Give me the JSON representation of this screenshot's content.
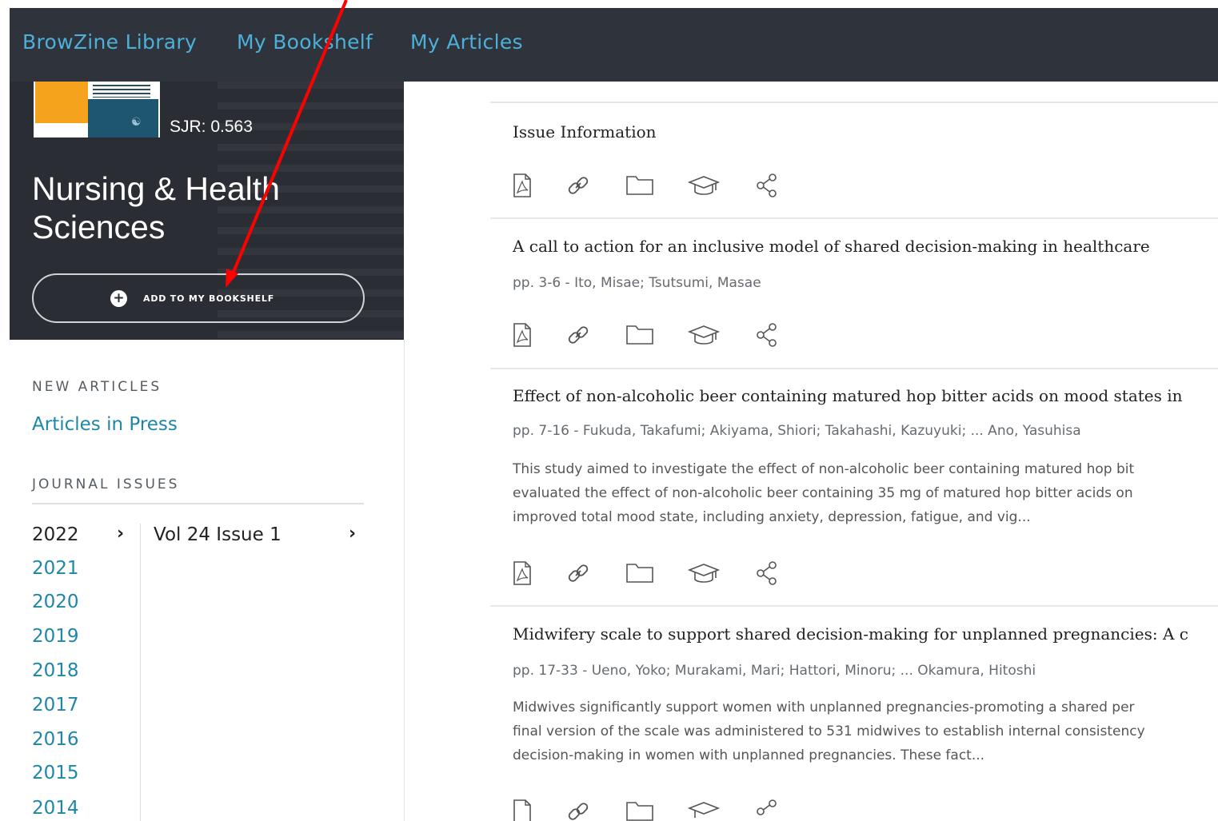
{
  "nav": {
    "items": [
      "BrowZine Library",
      "My Bookshelf",
      "My Articles"
    ]
  },
  "journal": {
    "sjr": "SJR: 0.563",
    "title": "Nursing & Health Sciences",
    "add_button": "ADD TO MY BOOKSHELF",
    "cover_icon": "journal-cover-thumbnail"
  },
  "sidebar": {
    "new_articles_heading": "NEW ARTICLES",
    "articles_in_press": "Articles in Press",
    "journal_issues_heading": "JOURNAL ISSUES",
    "years": [
      "2022",
      "2021",
      "2020",
      "2019",
      "2018",
      "2017",
      "2016",
      "2015",
      "2014"
    ],
    "selected_year": "2022",
    "issue": "Vol 24 Issue 1"
  },
  "articles": [
    {
      "title": "Issue Information",
      "meta": "",
      "abstract": []
    },
    {
      "title": "A call to action for an inclusive model of shared decision-making in healthcare",
      "meta": "pp. 3-6  -  Ito, Misae; Tsutsumi, Masae",
      "abstract": []
    },
    {
      "title": "Effect of non-alcoholic beer containing matured hop bitter acids on mood states in",
      "meta": "pp. 7-16  -  Fukuda, Takafumi; Akiyama, Shiori; Takahashi, Kazuyuki; ... Ano, Yasuhisa",
      "abstract": [
        "This study aimed to investigate the effect of non-alcoholic beer containing matured hop bit",
        "evaluated the effect of non-alcoholic beer containing 35 mg of matured hop bitter acids on",
        "improved total mood state, including anxiety, depression, fatigue, and vig..."
      ]
    },
    {
      "title": "Midwifery scale to support shared decision-making for unplanned pregnancies: A c",
      "meta": "pp. 17-33  -  Ueno, Yoko; Murakami, Mari; Hattori, Minoru; ... Okamura, Hitoshi",
      "abstract": [
        "Midwives significantly support women with unplanned pregnancies-promoting a shared per",
        "final version of the scale was administered to 531 midwives to establish internal consistency",
        "decision-making in women with unplanned pregnancies. These fact..."
      ]
    }
  ],
  "article_actions": [
    "pdf-icon",
    "link-icon",
    "folder-icon",
    "graduation-cap-icon",
    "share-icon"
  ],
  "colors": {
    "topbar": "#2f333b",
    "nav_link": "#4db0d9",
    "hero": "#2a2d33",
    "link": "#1e87a8",
    "annotation_arrow": "#ff0000"
  }
}
